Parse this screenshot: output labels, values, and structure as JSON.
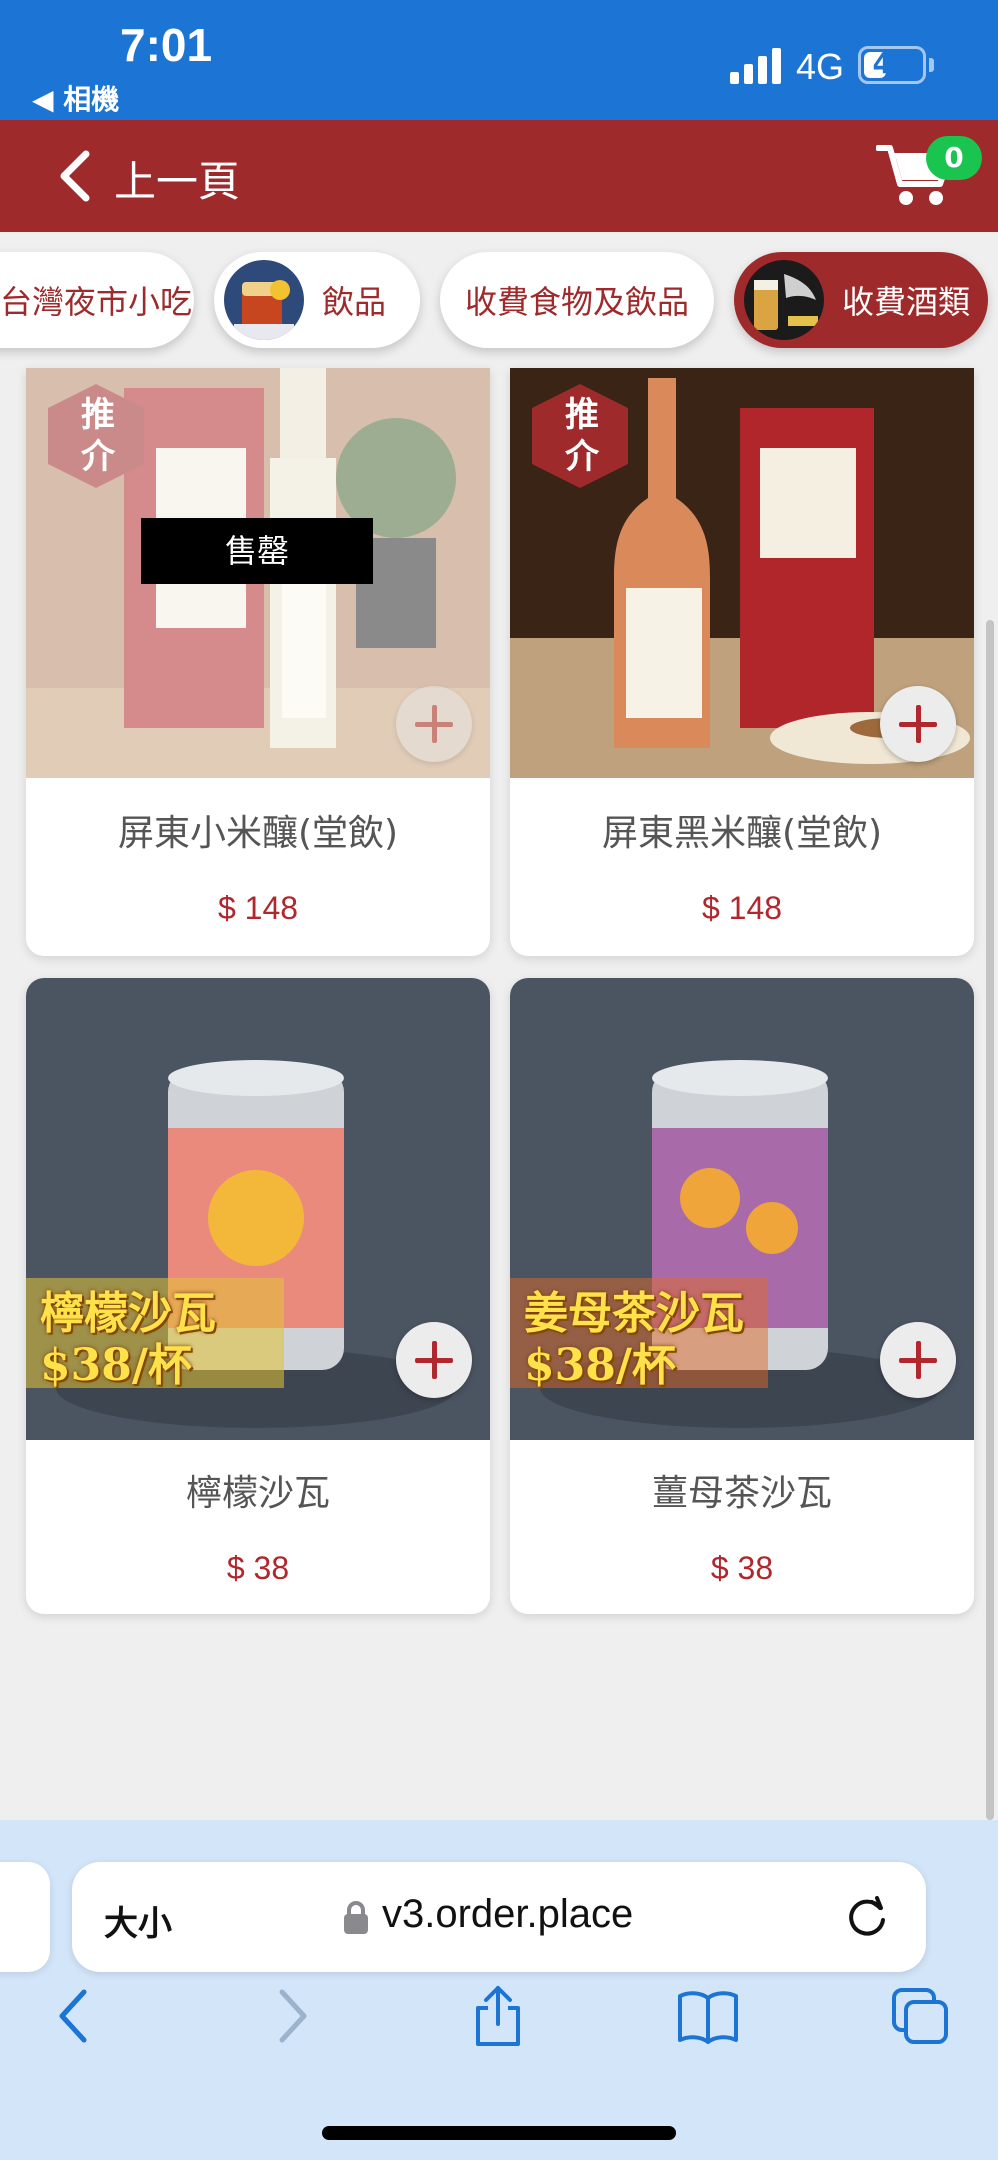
{
  "status_bar": {
    "time": "7:01",
    "back_app": "◀ 相機",
    "network": "4G",
    "battery": "40",
    "battery_level": 0.4
  },
  "header": {
    "back_label": "上一頁",
    "cart_count": "0",
    "brand_color": "#9e2a2b"
  },
  "categories": [
    {
      "label": "台灣夜市小吃",
      "active": false
    },
    {
      "label": "飲品",
      "active": false
    },
    {
      "label": "收費食物及飲品",
      "active": false
    },
    {
      "label": "收費酒類",
      "active": true
    }
  ],
  "products": [
    {
      "name": "屏東小米釀(堂飲)",
      "price": "$ 148",
      "badge": "推介",
      "sold_out": true,
      "sold_out_label": "售罄"
    },
    {
      "name": "屏東黑米釀(堂飲)",
      "price": "$ 148",
      "badge": "推介",
      "sold_out": false
    },
    {
      "name": "檸檬沙瓦",
      "price": "$ 38",
      "overlay_line1": "檸檬沙瓦",
      "overlay_line2": "$38/杯",
      "sold_out": false
    },
    {
      "name": "薑母茶沙瓦",
      "price": "$ 38",
      "overlay_line1": "姜母茶沙瓦",
      "overlay_line2": "$38/杯",
      "sold_out": false
    }
  ],
  "browser": {
    "text_size_label": "大小",
    "url": "v3.order.place"
  },
  "icons": {
    "back": "chevron-left-icon",
    "cart": "shopping-cart-icon",
    "add": "plus-icon",
    "lock": "lock-icon",
    "reload": "reload-icon",
    "nav_back": "browser-back-icon",
    "nav_forward": "browser-forward-icon",
    "share": "share-icon",
    "bookmarks": "bookmarks-icon",
    "tabs": "tabs-icon"
  }
}
